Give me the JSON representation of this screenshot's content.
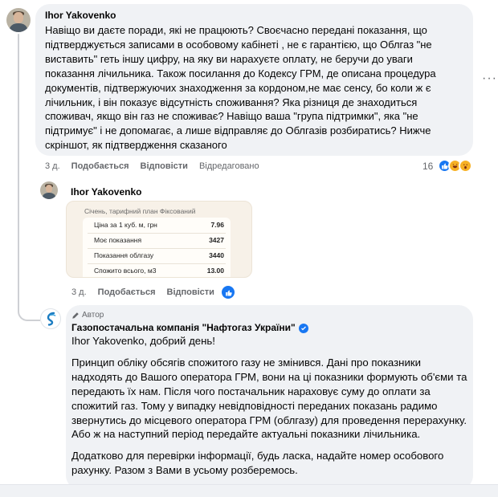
{
  "comment1": {
    "author": "Ihor Yakovenko",
    "text": "Навіщо ви даєте поради, які не працюють? Своєчасно передані показання, що підтверджується записами в особовому кабінеті , не є гарантією, що Облгаз \"не виставить\" геть іншу цифру, на яку ви нарахуєте оплату, не беручи до уваги показання лічильника. Також посилання до Кодексу ГРМ, де описана процедура документів, підтвержуючих знаходження за кордоном,не має сенсу, бо коли ж є лічильник, і він показує відсутність споживання? Яка різниця де знаходиться споживач, якщо він газ не споживає? Навіщо ваша \"група підтримки\", яка \"не підтримує\" і не допомагає, а лише відправляє до Облгазів розбиратись? Нижче скріншот, як підтвердження сказаного",
    "time": "3 д.",
    "like_label": "Подобається",
    "reply_label": "Відповісти",
    "edited_label": "Відредаговано",
    "reaction_count": "16",
    "more_label": "···"
  },
  "comment2": {
    "author": "Ihor Yakovenko",
    "time": "3 д.",
    "like_label": "Подобається",
    "reply_label": "Відповісти",
    "screenshot": {
      "title": "Січень, тарифний план Фіксований",
      "rows": [
        {
          "label": "Ціна за 1 куб. м, грн",
          "value": "7.96"
        },
        {
          "label": "Моє показання",
          "value": "3427"
        },
        {
          "label": "Показання облгазу",
          "value": "3440"
        },
        {
          "label": "Спожито всього, м3",
          "value": "13.00"
        }
      ]
    }
  },
  "comment3": {
    "badge": "Автор",
    "author": "Газопостачальна компанія \"Нафтогаз України\"",
    "mention": "Ihor Yakovenko",
    "greeting": ", добрий день!",
    "paragraphs": [
      "Принцип обліку обсягів спожитого газу не змінився. Дані про показники надходять до Вашого оператора ГРМ, вони на ці показники формують об'єми та передають їх нам. Після чого постачальник нараховує суму до оплати за спожитий газ. Тому у випадку невідповідності переданих показань радимо звернутись до місцевого оператора ГРМ (облгазу) для проведення перерахунку. Або ж на наступний період передайте актуальні показники лічильника.",
      "Додатково для перевірки інформації, будь ласка, надайте номер особового рахунку. Разом з Вами в усьому розберемось."
    ]
  },
  "colors": {
    "bubble": "#f0f2f5",
    "meta": "#65676b",
    "like": "#1877f2",
    "wow": "#f7b125"
  }
}
